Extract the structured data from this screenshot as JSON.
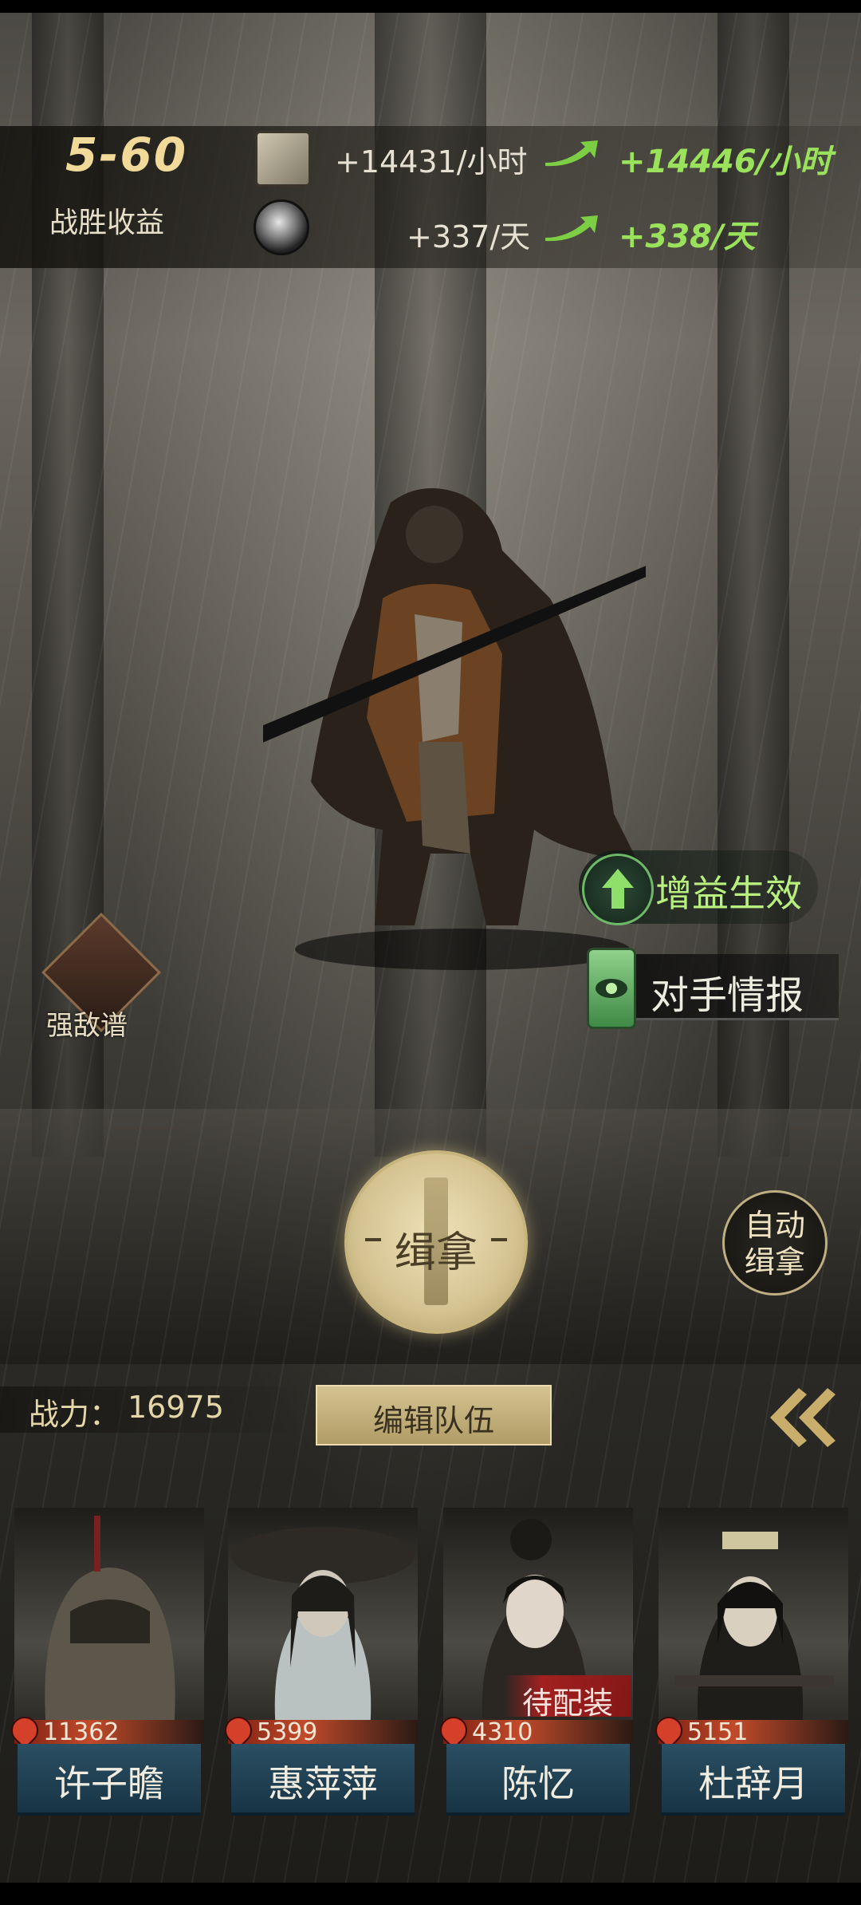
{
  "rewards": {
    "stage": "5-60",
    "stage_label": "战胜收益",
    "resource1": {
      "icon": "scroll-book-icon",
      "current": "+14431/小时",
      "upgraded": "+14446/小时"
    },
    "resource2": {
      "icon": "crystal-ore-icon",
      "current": "+337/天",
      "upgraded": "+338/天"
    },
    "up_color": "#9be25c"
  },
  "side": {
    "buff_label": "增益生效",
    "intel_label": "对手情报",
    "enemy_book_label": "强敌谱"
  },
  "actions": {
    "capture_label": "缉拿",
    "auto_capture_label": "自动\n缉拿",
    "auto_line1": "自动",
    "auto_line2": "缉拿",
    "power_label": "战力：",
    "power_value": "16975",
    "edit_team_label": "编辑队伍"
  },
  "team": [
    {
      "name": "许子瞻",
      "power": "11362",
      "pending": ""
    },
    {
      "name": "惠萍萍",
      "power": "5399",
      "pending": ""
    },
    {
      "name": "陈忆",
      "power": "4310",
      "pending": "待配装"
    },
    {
      "name": "杜辞月",
      "power": "5151",
      "pending": ""
    }
  ]
}
